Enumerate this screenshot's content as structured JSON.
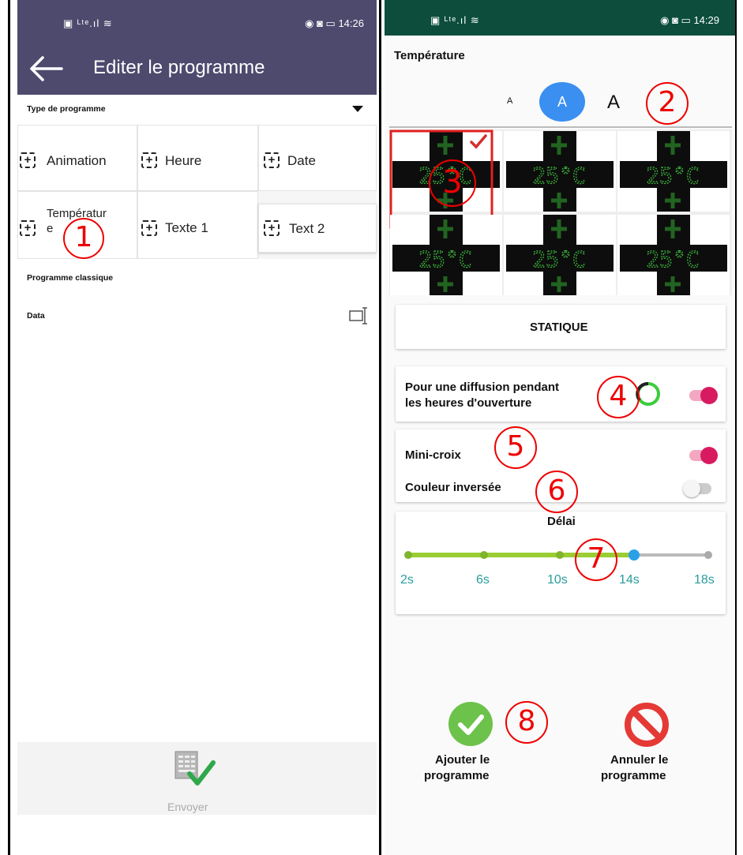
{
  "left": {
    "status": {
      "left": "▣ ᴸᵗᵉ.ıl ≋",
      "right": "◉ ◙ ▭ 14:26"
    },
    "appbar": {
      "title": "Editer le programme"
    },
    "type_programme_label": "Type de programme",
    "grid": [
      {
        "label": "Animation"
      },
      {
        "label": "Heure"
      },
      {
        "label": "Date"
      },
      {
        "label": "Températur e"
      },
      {
        "label": "Texte 1"
      },
      {
        "label": "Text 2"
      }
    ],
    "programme_classique": "Programme classique",
    "data_label": "Data",
    "send_label": "Envoyer"
  },
  "right": {
    "status": {
      "left": "▣ ᴸᵗᵉ.ıl ≋",
      "right": "◉ ◙ ▭ 14:29"
    },
    "title": "Température",
    "size_options": [
      "A",
      "A",
      "A"
    ],
    "tile_text": "25°C",
    "mode_button": "STATIQUE",
    "opening_hours_line1": "Pour une diffusion pendant",
    "opening_hours_line2": "les heures d'ouverture",
    "mini_croix": "Mini-croix",
    "couleur_inversee": "Couleur inversée",
    "delai_label": "Délai",
    "slider_ticks": [
      "2s",
      "6s",
      "10s",
      "14s",
      "18s"
    ],
    "slider_value": "14s",
    "add_line1": "Ajouter le",
    "add_line2": "programme",
    "cancel_line1": "Annuler le",
    "cancel_line2": "programme"
  },
  "annotations": [
    "1",
    "2",
    "3",
    "4",
    "5",
    "6",
    "7",
    "8"
  ],
  "colors": {
    "left_header": "#4e4a6e",
    "right_header": "#0c4d3c",
    "accent_blue": "#3a8ff0",
    "toggle_on": "#d81b60",
    "slider_green": "#9acd32",
    "annotation_red": "#e00000",
    "led_green": "#2e9e2e"
  },
  "icons": [
    "back-arrow-icon",
    "dropdown-triangle-icon",
    "plus-dashed-icon",
    "edit-field-icon",
    "send-keyboard-icon",
    "check-icon",
    "forbidden-icon",
    "ring-icon"
  ]
}
